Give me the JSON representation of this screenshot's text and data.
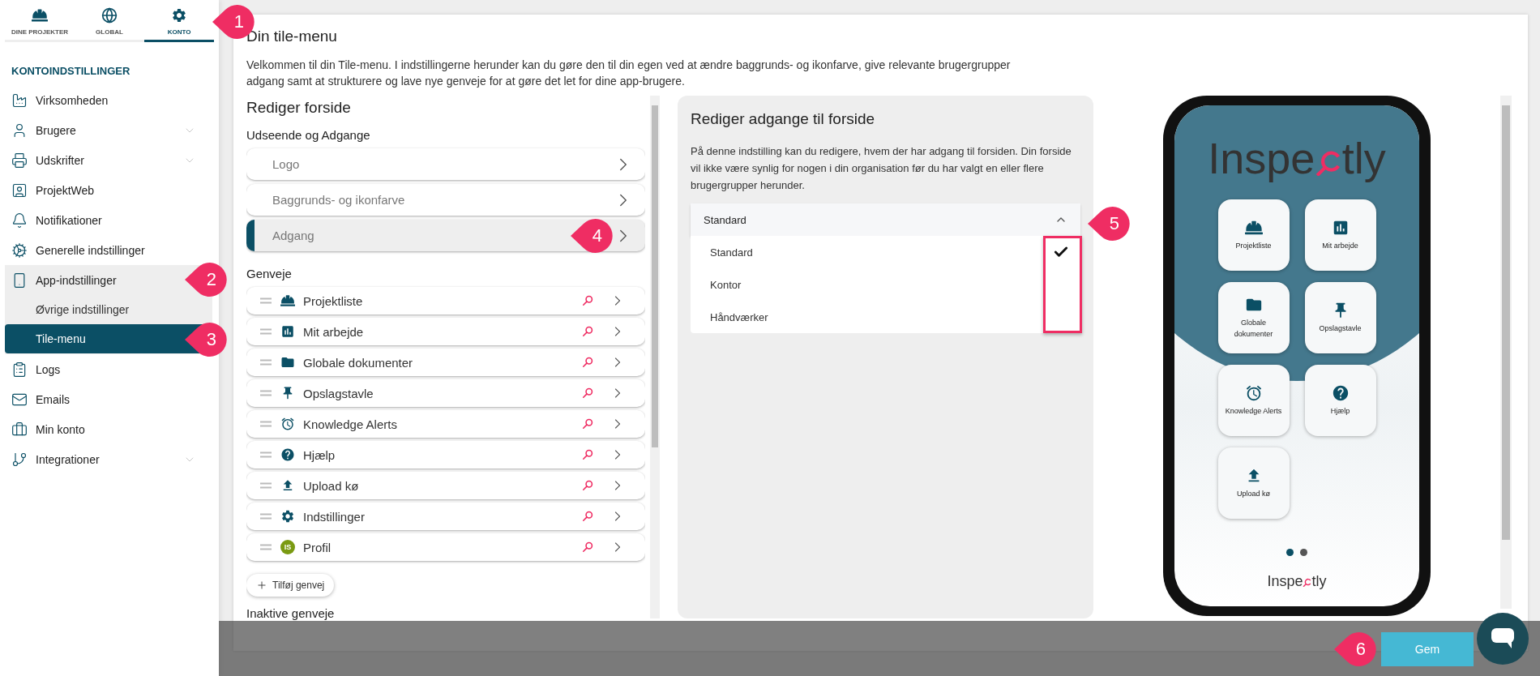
{
  "sidebar": {
    "tabs": [
      {
        "label": "DINE PROJEKTER",
        "kind": "hardhat",
        "selected": false
      },
      {
        "label": "GLOBAL",
        "kind": "globe",
        "selected": false
      },
      {
        "label": "KONTO",
        "kind": "gear",
        "selected": true
      }
    ],
    "heading": "KONTOINDSTILLINGER",
    "items": [
      {
        "label": "Virksomheden",
        "kind": "factory",
        "selected": false
      },
      {
        "label": "Brugere",
        "kind": "user",
        "selected": false,
        "expanded": false
      },
      {
        "label": "Udskrifter",
        "kind": "printer",
        "selected": false,
        "expanded": false
      },
      {
        "label": "ProjektWeb",
        "kind": "contact",
        "selected": false
      },
      {
        "label": "Notifikationer",
        "kind": "bell",
        "selected": false
      },
      {
        "label": "Generelle indstillinger",
        "kind": "cogs",
        "selected": false
      },
      {
        "label": "App-indstillinger",
        "kind": "phone",
        "selected": false,
        "expanded": true,
        "children": [
          {
            "label": "Øvrige indstillinger",
            "selected": false
          },
          {
            "label": "Tile-menu",
            "selected": true
          }
        ]
      },
      {
        "label": "Logs",
        "kind": "clipboard",
        "selected": false
      },
      {
        "label": "Emails",
        "kind": "mail",
        "selected": false
      },
      {
        "label": "Min konto",
        "kind": "briefcase",
        "selected": false
      },
      {
        "label": "Integrationer",
        "kind": "branch",
        "selected": false,
        "expanded": false
      }
    ]
  },
  "main": {
    "title": "Din tile-menu",
    "description": "Velkommen til din Tile-menu. I indstillingerne herunder kan du gøre den til din egen ved at ændre baggrunds- og ikonfarve, give relevante brugergrupper adgang samt at strukturere og lave nye genveje for at gøre det let for dine app-brugere.",
    "editor": {
      "heading": "Rediger forside",
      "appearance": {
        "heading": "Udseende og Adgange",
        "items": [
          {
            "label": "Logo",
            "selected": false
          },
          {
            "label": "Baggrunds- og ikonfarve",
            "selected": false
          },
          {
            "label": "Adgang",
            "selected": true
          }
        ]
      },
      "shortcuts": {
        "heading": "Genveje",
        "items": [
          {
            "label": "Projektliste",
            "kind": "hardhat"
          },
          {
            "label": "Mit arbejde",
            "kind": "report"
          },
          {
            "label": "Globale dokumenter",
            "kind": "folder"
          },
          {
            "label": "Opslagstavle",
            "kind": "pin"
          },
          {
            "label": "Knowledge Alerts",
            "kind": "alarm"
          },
          {
            "label": "Hjælp",
            "kind": "help"
          },
          {
            "label": "Upload kø",
            "kind": "upload"
          },
          {
            "label": "Indstillinger",
            "kind": "gear"
          },
          {
            "label": "Profil",
            "kind": "avatar",
            "initials": "IS"
          }
        ]
      },
      "add_button": "Tilføj genvej",
      "inactive_heading": "Inaktive genveje"
    },
    "access_panel": {
      "heading": "Rediger adgange til forside",
      "description": "På denne indstilling kan du redigere, hvem der har adgang til forsiden. Din forside vil ikke være synlig for nogen i din organisation før du har valgt en eller flere brugergrupper herunder.",
      "dropdown": {
        "value": "Standard",
        "expanded": true,
        "options": [
          {
            "label": "Standard",
            "checked": true
          },
          {
            "label": "Kontor",
            "checked": false
          },
          {
            "label": "Håndværker",
            "checked": false
          }
        ]
      }
    },
    "preview": {
      "logo_start": "Inspe",
      "logo_end": "tly",
      "tiles": [
        {
          "label": "Projektliste",
          "kind": "hardhat"
        },
        {
          "label": "Mit arbejde",
          "kind": "report"
        },
        {
          "label": "Globale dokumenter",
          "kind": "folder"
        },
        {
          "label": "Opslagstavle",
          "kind": "pin"
        },
        {
          "label": "Knowledge Alerts",
          "kind": "alarm"
        },
        {
          "label": "Hjælp",
          "kind": "help"
        },
        {
          "label": "Upload kø",
          "kind": "upload"
        }
      ],
      "pages": [
        {
          "selected": true
        },
        {
          "selected": false
        }
      ],
      "footer_logo_start": "Inspe",
      "footer_logo_end": "tly"
    }
  },
  "save_button": "Gem",
  "callouts": [
    "1",
    "2",
    "3",
    "4",
    "5",
    "6"
  ]
}
